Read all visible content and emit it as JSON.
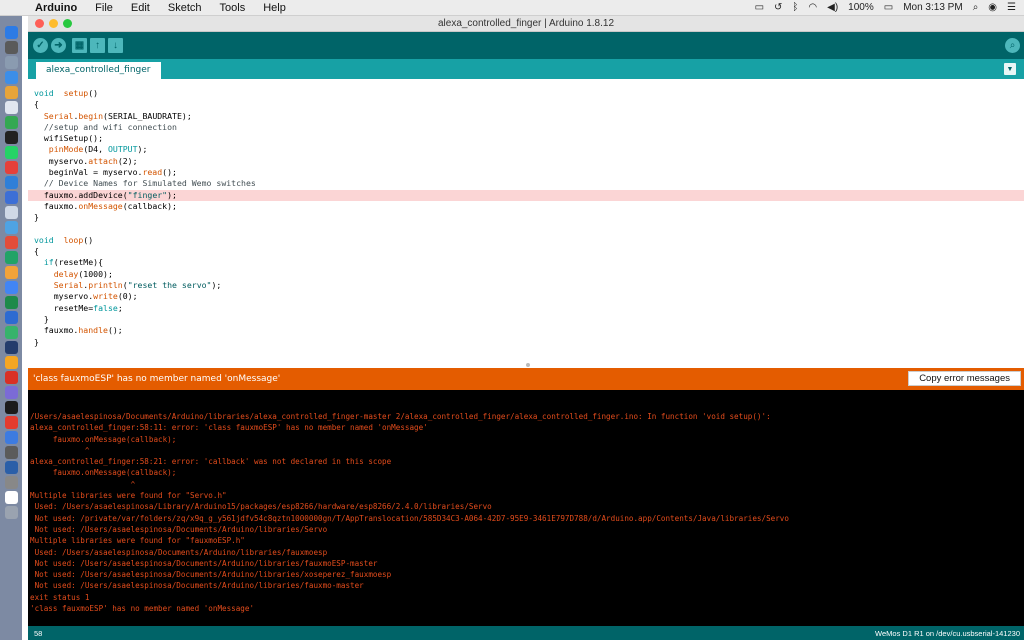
{
  "menubar": {
    "app_name": "Arduino",
    "items": [
      "File",
      "Edit",
      "Sketch",
      "Tools",
      "Help"
    ],
    "battery": "100%",
    "clock": "Mon 3:13 PM"
  },
  "window": {
    "title": "alexa_controlled_finger | Arduino 1.8.12",
    "traffic_colors": [
      "#fe5f57",
      "#febc2e",
      "#28c840"
    ]
  },
  "toolbar": {
    "buttons": [
      {
        "name": "verify-button",
        "icon": "check-icon",
        "glyph": "✓"
      },
      {
        "name": "upload-button",
        "icon": "arrow-right-icon",
        "glyph": "➜"
      },
      {
        "name": "new-button",
        "icon": "new-file-icon",
        "glyph": "▦"
      },
      {
        "name": "open-button",
        "icon": "arrow-up-icon",
        "glyph": "↑"
      },
      {
        "name": "save-button",
        "icon": "arrow-down-icon",
        "glyph": "↓"
      }
    ],
    "serial_monitor_icon": "magnifier-icon"
  },
  "tabs": {
    "active": "alexa_controlled_finger"
  },
  "editor": {
    "error_line_index": 9,
    "lines": [
      [
        [
          "kw",
          "void"
        ],
        [
          "",
          "  "
        ],
        [
          "fn",
          "setup"
        ],
        [
          "",
          "()"
        ]
      ],
      [
        [
          "",
          "{"
        ]
      ],
      [
        [
          "",
          "  "
        ],
        [
          "fn",
          "Serial"
        ],
        [
          "",
          "."
        ],
        [
          "fn",
          "begin"
        ],
        [
          "",
          "(SERIAL_BAUDRATE);"
        ]
      ],
      [
        [
          "cm",
          "  //setup and wifi connection"
        ]
      ],
      [
        [
          "",
          "  wifiSetup();"
        ]
      ],
      [
        [
          "",
          "   "
        ],
        [
          "fn",
          "pinMode"
        ],
        [
          "",
          "(D4, "
        ],
        [
          "const",
          "OUTPUT"
        ],
        [
          "",
          ");"
        ]
      ],
      [
        [
          "",
          "   myservo."
        ],
        [
          "fn",
          "attach"
        ],
        [
          "",
          "(2);"
        ]
      ],
      [
        [
          "",
          "   beginVal = myservo."
        ],
        [
          "fn",
          "read"
        ],
        [
          "",
          "();"
        ]
      ],
      [
        [
          "cm",
          "  // Device Names for Simulated Wemo switches"
        ]
      ],
      [
        [
          "",
          "  fauxmo.addDevice("
        ],
        [
          "str",
          "\"finger\""
        ],
        [
          "",
          ");"
        ]
      ],
      [
        [
          "",
          "  fauxmo."
        ],
        [
          "fn",
          "onMessage"
        ],
        [
          "",
          "(callback);"
        ]
      ],
      [
        [
          "",
          "}"
        ]
      ],
      [
        [
          "",
          ""
        ]
      ],
      [
        [
          "kw",
          "void"
        ],
        [
          "",
          "  "
        ],
        [
          "fn",
          "loop"
        ],
        [
          "",
          "()"
        ]
      ],
      [
        [
          "",
          "{"
        ]
      ],
      [
        [
          "",
          "  "
        ],
        [
          "kw",
          "if"
        ],
        [
          "",
          "(resetMe){"
        ]
      ],
      [
        [
          "",
          "    "
        ],
        [
          "fn",
          "delay"
        ],
        [
          "",
          "(1000);"
        ]
      ],
      [
        [
          "",
          "    "
        ],
        [
          "fn",
          "Serial"
        ],
        [
          "",
          "."
        ],
        [
          "fn",
          "println"
        ],
        [
          "",
          "("
        ],
        [
          "str",
          "\"reset the servo\""
        ],
        [
          "",
          ");"
        ]
      ],
      [
        [
          "",
          "    myservo."
        ],
        [
          "fn",
          "write"
        ],
        [
          "",
          "(0);"
        ]
      ],
      [
        [
          "",
          "    resetMe="
        ],
        [
          "const",
          "false"
        ],
        [
          "",
          ";"
        ]
      ],
      [
        [
          "",
          "  }"
        ]
      ],
      [
        [
          "",
          "  fauxmo."
        ],
        [
          "fn",
          "handle"
        ],
        [
          "",
          "();"
        ]
      ],
      [
        [
          "",
          "}"
        ]
      ]
    ]
  },
  "error_bar": {
    "message": "'class fauxmoESP' has no member named 'onMessage'",
    "copy_label": "Copy error messages"
  },
  "console": {
    "lines": [
      "/Users/asaelespinosa/Documents/Arduino/libraries/alexa_controlled_finger-master 2/alexa_controlled_finger/alexa_controlled_finger.ino: In function 'void setup()':",
      "alexa_controlled_finger:58:11: error: 'class fauxmoESP' has no member named 'onMessage'",
      "     fauxmo.onMessage(callback);",
      "            ^",
      "alexa_controlled_finger:58:21: error: 'callback' was not declared in this scope",
      "     fauxmo.onMessage(callback);",
      "                      ^",
      "Multiple libraries were found for \"Servo.h\"",
      " Used: /Users/asaelespinosa/Library/Arduino15/packages/esp8266/hardware/esp8266/2.4.0/libraries/Servo",
      " Not used: /private/var/folders/zq/x9q_g_y561jdfv54c8qztn1000000gn/T/AppTranslocation/585D34C3-A064-42D7-95E9-3461E797D788/d/Arduino.app/Contents/Java/libraries/Servo",
      " Not used: /Users/asaelespinosa/Documents/Arduino/libraries/Servo",
      "Multiple libraries were found for \"fauxmoESP.h\"",
      " Used: /Users/asaelespinosa/Documents/Arduino/libraries/fauxmoesp",
      " Not used: /Users/asaelespinosa/Documents/Arduino/libraries/fauxmoESP-master",
      " Not used: /Users/asaelespinosa/Documents/Arduino/libraries/xoseperez_fauxmoesp",
      " Not used: /Users/asaelespinosa/Documents/Arduino/libraries/fauxmo-master",
      "exit status 1",
      "'class fauxmoESP' has no member named 'onMessage'"
    ]
  },
  "statusbar": {
    "line_number": "58",
    "board": "WeMos D1 R1 on /dev/cu.usbserial-141230"
  },
  "dock_colors": [
    "#2d7be5",
    "#5a5a5a",
    "#8a9bb0",
    "#3c8ee8",
    "#e7a43a",
    "#e0e6f0",
    "#34a853",
    "#222222",
    "#25d366",
    "#e5403a",
    "#2f7fd8",
    "#3d6fd6",
    "#cfd8e6",
    "#4fa3e3",
    "#e24d3a",
    "#21a366",
    "#f2a33a",
    "#4285f4",
    "#1d8a4a",
    "#2e6bd1",
    "#37b36b",
    "#243c6c",
    "#f5a623",
    "#d93025",
    "#7b6bd6",
    "#1b1b1b",
    "#e33b2e",
    "#3d7be0",
    "#5b5b5b",
    "#2b5fa8",
    "#888888",
    "#ffffff",
    "#9aa3b0"
  ]
}
